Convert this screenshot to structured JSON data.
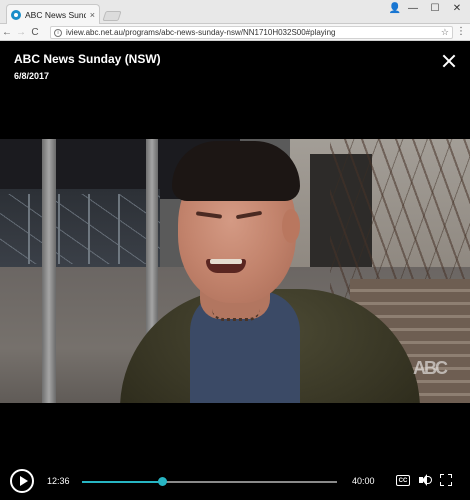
{
  "browser": {
    "tab_title": "ABC News Sunday (NSW",
    "tab_close": "×",
    "url": "iview.abc.net.au/programs/abc-news-sunday-nsw/NN1710H032S00#playing",
    "window_controls": {
      "user": "👤",
      "minimize": "—",
      "maximize": "☐",
      "close": "✕"
    },
    "nav": {
      "back": "←",
      "forward": "→",
      "reload": "C"
    },
    "star": "☆",
    "menu": "⋮",
    "info": "i"
  },
  "player": {
    "title": "ABC News Sunday (NSW)",
    "date": "6/8/2017",
    "watermark": "ABC",
    "current_time": "12:36",
    "total_time": "40:00",
    "progress": 0.315,
    "cc_label": "CC",
    "accent_color": "#27b5c3"
  }
}
